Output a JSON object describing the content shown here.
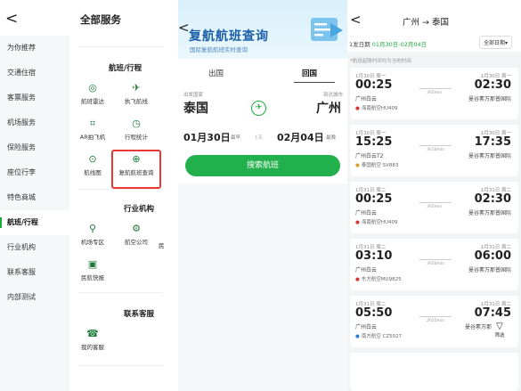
{
  "services": {
    "back": "<",
    "title": "全部服务",
    "sidebar": [
      "为你推荐",
      "交通住宿",
      "客票服务",
      "机场服务",
      "保险服务",
      "座位行李",
      "特色商城",
      "航班/行程",
      "行业机构",
      "联系客服",
      "内部测试"
    ],
    "active_index": 7,
    "section_flight": "航班/行程",
    "flight_items": [
      {
        "icon": "◎",
        "label": "航班雷达"
      },
      {
        "icon": "✈",
        "label": "执飞航线"
      },
      {
        "icon": "⌗",
        "label": "AR拍飞机"
      },
      {
        "icon": "◷",
        "label": "行程统计"
      },
      {
        "icon": "⊙",
        "label": "航线图"
      },
      {
        "icon": "⊕",
        "label": "复航航班查询"
      }
    ],
    "section_industry": "行业机构",
    "industry_items": [
      {
        "icon": "⚲",
        "label": "机场专区"
      },
      {
        "icon": "⚙",
        "label": "航空公司"
      },
      {
        "icon": "▣",
        "label": "民航快报"
      }
    ],
    "industry_cut": "民",
    "section_contact": "联系客服",
    "contact_items": [
      {
        "icon": "☎",
        "label": "我的客服"
      }
    ]
  },
  "search": {
    "back": "<",
    "title": "复航航班查询",
    "subtitle": "国际复航航班实时查询",
    "tab_outbound": "出国",
    "tab_return": "回国",
    "from_label": "出发国家",
    "to_label": "到达城市",
    "from_city": "泰国",
    "to_city": "广州",
    "swap_icon": "✈",
    "date_depart": "01月30日",
    "date_depart_tag": "最早",
    "date_span": "1天",
    "date_return": "02月04日",
    "date_return_tag": "最晚",
    "button": "搜索航班"
  },
  "results": {
    "back": "<",
    "route": "广州 → 泰国",
    "dates_label": "1发日期",
    "dates_value": "01月30日-02月04日",
    "all_dates": "全部日期▾",
    "note": "*航班起降时间均为当地时间",
    "flights": [
      {
        "d1": "1月30日 周一",
        "d2": "1月30日 周一",
        "t1": "00:25",
        "t2": "02:30",
        "a1": "广州白云",
        "a2": "曼谷素万那普国际",
        "airline": "海南航空HU409",
        "dur": "3h5min"
      },
      {
        "d1": "1月30日 周一",
        "d2": "1月30日 周一",
        "t1": "15:25",
        "t2": "17:35",
        "a1": "广州白云T2",
        "a2": "曼谷素万那普国际",
        "airline": "泰国航空 SV883",
        "dur": "3h10min"
      },
      {
        "d1": "1月31日 周二",
        "d2": "1月31日 周二",
        "t1": "00:25",
        "t2": "02:30",
        "a1": "广州白云",
        "a2": "曼谷素万那普国际",
        "airline": "海南航空HU409",
        "dur": "3h5min"
      },
      {
        "d1": "1月31日 周二",
        "d2": "1月31日 周二",
        "t1": "03:10",
        "t2": "06:00",
        "a1": "广州白云",
        "a2": "曼谷素万那普国际",
        "airline": "东方航空MU9825",
        "dur": "3h50min"
      },
      {
        "d1": "1月31日 周二",
        "d2": "1月31日 周二",
        "t1": "05:50",
        "t2": "07:45",
        "a1": "广州白云",
        "a2": "曼谷素万那",
        "airline": "南方航空 CZ5027",
        "dur": "2h55min"
      }
    ],
    "filter_label": "筛选",
    "filter_icon": "▽"
  }
}
